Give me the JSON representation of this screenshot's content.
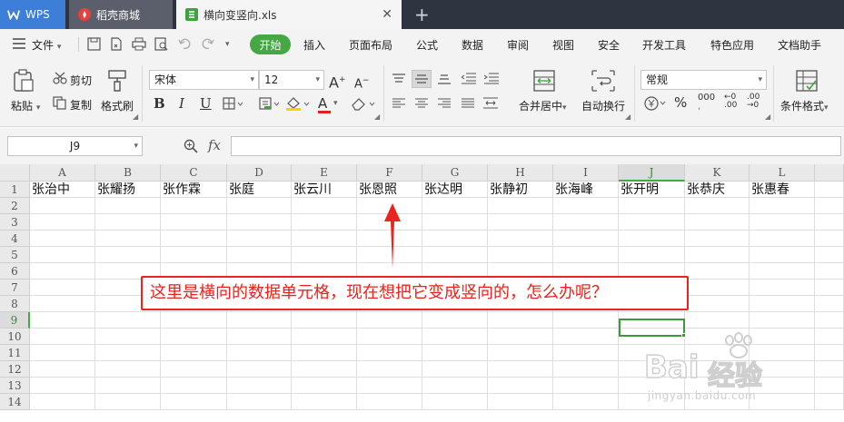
{
  "tabs": {
    "wps_label": "WPS",
    "docer_label": "稻壳商城",
    "file_label": "横向变竖向.xls"
  },
  "menu": {
    "file_label": "文件",
    "start_label": "开始",
    "items": [
      "插入",
      "页面布局",
      "公式",
      "数据",
      "审阅",
      "视图",
      "安全",
      "开发工具",
      "特色应用",
      "文档助手"
    ]
  },
  "ribbon": {
    "paste_label": "粘贴",
    "cut_label": "剪切",
    "copy_label": "复制",
    "format_painter_label": "格式刷",
    "font_name": "宋体",
    "font_size": "12",
    "merge_center_label": "合并居中",
    "wrap_text_label": "自动换行",
    "number_format": "常规",
    "conditional_format_label": "条件格式",
    "bold_label": "B",
    "italic_label": "I",
    "underline_label": "U",
    "font_color_label": "A",
    "percent_label": "%",
    "thousands_label": "000"
  },
  "formula_bar": {
    "name_box": "J9",
    "fx_label": "fx",
    "content": ""
  },
  "sheet": {
    "columns": [
      "A",
      "B",
      "C",
      "D",
      "E",
      "F",
      "G",
      "H",
      "I",
      "J",
      "K",
      "L"
    ],
    "rows": [
      "1",
      "2",
      "3",
      "4",
      "5",
      "6",
      "7",
      "8",
      "9",
      "10",
      "11",
      "12",
      "13",
      "14"
    ],
    "row1_values": [
      "张治中",
      "张耀扬",
      "张作霖",
      "张庭",
      "张云川",
      "张恩照",
      "张达明",
      "张静初",
      "张海峰",
      "张开明",
      "张恭庆",
      "张惠春"
    ],
    "active_column": "J",
    "active_row": "9"
  },
  "annotation": {
    "text": "这里是横向的数据单元格，现在想把它变成竖向的，怎么办呢？",
    "color": "#e8241c"
  },
  "watermark": {
    "brand": "Bai",
    "brand_suffix": "经验",
    "url": "jingyan.baidu.com"
  },
  "colors": {
    "accent_green": "#45a845",
    "tab_blue": "#3d7fd8",
    "annotation_red": "#e8241c"
  }
}
